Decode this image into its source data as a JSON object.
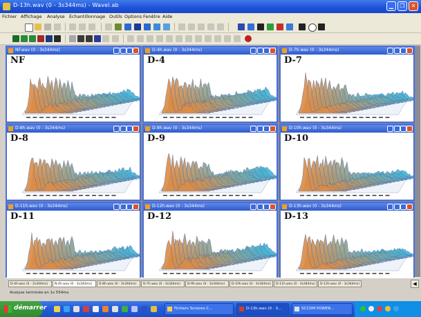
{
  "window": {
    "title": "D-13h.wav (0 - 3s344ms) - Wavel.ab"
  },
  "menu": [
    "Fichier",
    "Affichage",
    "Analyse",
    "Echantillonnage",
    "Outils",
    "Options",
    "Fenêtre",
    "Aide"
  ],
  "windows": [
    {
      "title": "NF.wav (0 - 3s344ms)",
      "label": "NF",
      "seed": 1
    },
    {
      "title": "D-4h.wav (0 - 3s344ms)",
      "label": "D-4",
      "seed": 2
    },
    {
      "title": "D-7h.wav (0 - 3s344ms)",
      "label": "D-7",
      "seed": 3
    },
    {
      "title": "D-8h.wav (0 - 3s344ms)",
      "label": "D-8",
      "seed": 4
    },
    {
      "title": "D-9h.wav (0 - 3s344ms)",
      "label": "D-9",
      "seed": 5
    },
    {
      "title": "D-10h.wav (0 - 3s344ms)",
      "label": "D-10",
      "seed": 6
    },
    {
      "title": "D-11h.wav (0 - 3s344ms)",
      "label": "D-11",
      "seed": 7
    },
    {
      "title": "D-12h.wav (0 - 3s344ms)",
      "label": "D-12",
      "seed": 8
    },
    {
      "title": "D-13h.wav (0 - 3s344ms)",
      "label": "D-13",
      "seed": 9
    }
  ],
  "window_tabs": [
    "D-4h.wav (0 - 3s344ms)",
    "N-4h.wav (0 - 3s344ms)",
    "D-8h.wav (0 - 3s344ms)",
    "D-7h.wav (0 - 3s344ms)",
    "D-9h.wav (0 - 3s344ms)",
    "D-10h.wav (0 - 3s344ms)",
    "D-11h.wav (0 - 3s344ms)",
    "D-12h.wav (0 - 3s344ms)"
  ],
  "active_tab_index": 1,
  "status": "Analyse terminée en 1s 554ms",
  "taskbar": {
    "start": "démarrer",
    "tasks": [
      "Fichiers Sonores C...",
      "D-13h.wav (0 - 3...",
      "SCCDM POWER..."
    ]
  },
  "colors": {
    "titlebar": "#2458dc",
    "spectrum_low": "#3d8fd6",
    "spectrum_high": "#e8b020"
  }
}
